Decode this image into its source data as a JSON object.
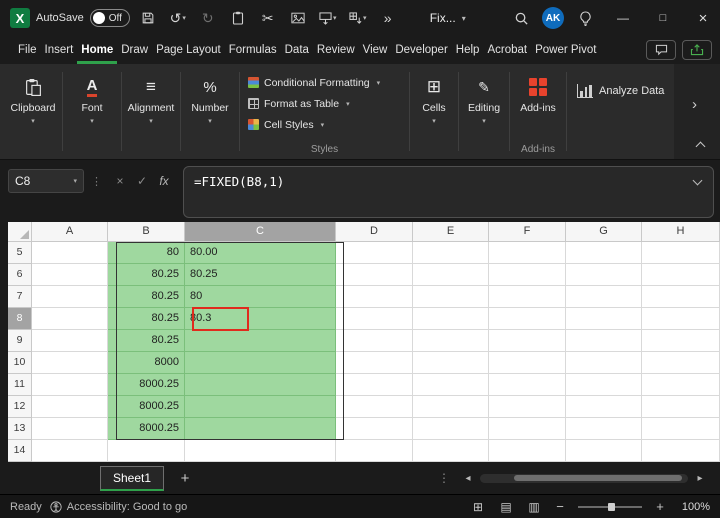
{
  "colors": {
    "accent_green": "#2fa14b",
    "excel_logo_green": "#107c41",
    "cell_fill_green": "#9fd89f",
    "annotation_red": "#e02b1d",
    "avatar_blue": "#0f6cbd",
    "addins_orange": "#e8432d"
  },
  "glyphs": {
    "undo": "↺",
    "redo": "↻",
    "scissors": "✂",
    "chevron_down": "▾",
    "overflow": "»",
    "dots_vertical": "⋮",
    "close": "×",
    "maximize": "□",
    "minimize": "—",
    "cancel": "×",
    "enter_check": "✓",
    "fx": "fx",
    "alignment": "≡",
    "percent": "%",
    "font_a": "A",
    "cells_grid": "⊞",
    "editing_pencil": "✎",
    "plus": "+",
    "minus": "−",
    "scroll_left": "◂",
    "scroll_right": "▸",
    "view_normal": "⊞",
    "view_page_layout": "▤",
    "view_page_break": "▥",
    "more_right": "›"
  },
  "titlebar": {
    "autosave_label": "AutoSave",
    "autosave_state": "Off",
    "doc_name": "Fix...",
    "avatar_initials": "AK"
  },
  "menubar": {
    "items": [
      "File",
      "Insert",
      "Home",
      "Draw",
      "Page Layout",
      "Formulas",
      "Data",
      "Review",
      "View",
      "Developer",
      "Help",
      "Acrobat",
      "Power Pivot"
    ],
    "active_item": "Home"
  },
  "ribbon": {
    "collapsed_groups": [
      "Clipboard",
      "Font",
      "Alignment",
      "Number"
    ],
    "styles": {
      "items": [
        "Conditional Formatting",
        "Format as Table",
        "Cell Styles"
      ],
      "footer": "Styles"
    },
    "cells_label": "Cells",
    "editing_label": "Editing",
    "addins": {
      "label": "Add-ins",
      "footer": "Add-ins"
    },
    "analyze_label": "Analyze Data"
  },
  "formula_bar": {
    "name_box": "C8",
    "formula": "=FIXED(B8,1)"
  },
  "grid": {
    "columns": [
      "A",
      "B",
      "C",
      "D",
      "E",
      "F",
      "G",
      "H"
    ],
    "active_cell": "C8",
    "rows": [
      {
        "n": "5",
        "b": "80",
        "c": "80.00"
      },
      {
        "n": "6",
        "b": "80.25",
        "c": "80.25"
      },
      {
        "n": "7",
        "b": "80.25",
        "c": "80"
      },
      {
        "n": "8",
        "b": "80.25",
        "c": "80.3"
      },
      {
        "n": "9",
        "b": "80.25",
        "c": ""
      },
      {
        "n": "10",
        "b": "8000",
        "c": ""
      },
      {
        "n": "11",
        "b": "8000.25",
        "c": ""
      },
      {
        "n": "12",
        "b": "8000.25",
        "c": ""
      },
      {
        "n": "13",
        "b": "8000.25",
        "c": ""
      },
      {
        "n": "14",
        "b": "",
        "c": ""
      }
    ]
  },
  "sheet_tabs": {
    "active_tab": "Sheet1"
  },
  "status_bar": {
    "mode": "Ready",
    "accessibility": "Accessibility: Good to go",
    "zoom_level": "100%"
  }
}
